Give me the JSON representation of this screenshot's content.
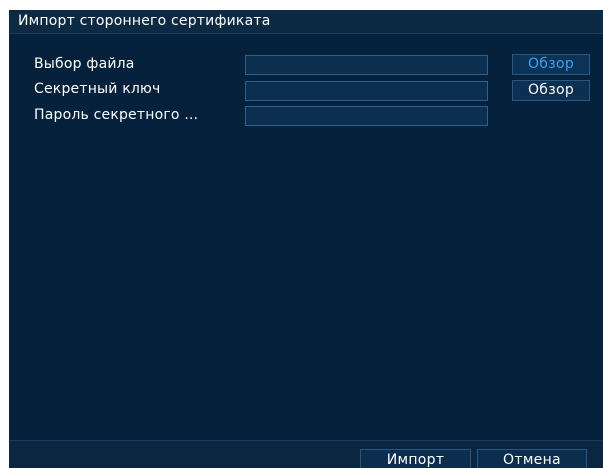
{
  "dialog": {
    "title": "Импорт стороннего сертификата"
  },
  "form": {
    "rows": [
      {
        "label": "Выбор файла",
        "value": "",
        "button_label": "Обзор"
      },
      {
        "label": "Секретный ключ",
        "value": "",
        "button_label": "Обзор"
      },
      {
        "label": "Пароль секретного ...",
        "value": ""
      }
    ]
  },
  "footer": {
    "import_label": "Импорт",
    "cancel_label": "Отмена"
  },
  "colors": {
    "background": "#06213b",
    "field_border": "#2f5f8b",
    "active_button_text": "#3aa2f0"
  }
}
